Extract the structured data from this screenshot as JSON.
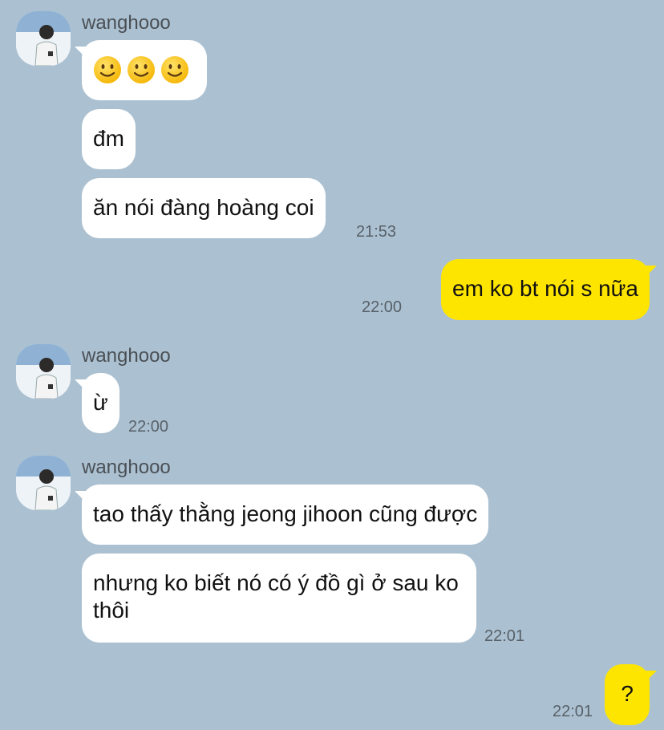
{
  "theme": {
    "background": "#abc1d1",
    "incoming_bubble": "#ffffff",
    "outgoing_bubble": "#fee500"
  },
  "groups": [
    {
      "sender": "wanghooo",
      "avatar_icon": "user-photo-avatar",
      "messages": [
        {
          "type": "emoji",
          "emojis": [
            "slightly-smiling-face-icon",
            "slightly-smiling-face-icon",
            "slightly-smiling-face-icon"
          ]
        },
        {
          "type": "text",
          "text": "đm"
        },
        {
          "type": "text",
          "text": "ăn nói đàng hoàng coi"
        }
      ],
      "time": "21:53"
    },
    {
      "outgoing": true,
      "messages": [
        {
          "type": "text",
          "text": "em ko bt nói s nữa"
        }
      ],
      "time": "22:00"
    },
    {
      "sender": "wanghooo",
      "avatar_icon": "user-photo-avatar",
      "messages": [
        {
          "type": "text",
          "text": "ừ"
        }
      ],
      "time": "22:00"
    },
    {
      "sender": "wanghooo",
      "avatar_icon": "user-photo-avatar",
      "messages": [
        {
          "type": "text",
          "text": "tao thấy thằng jeong jihoon cũng được"
        },
        {
          "type": "text",
          "text": "nhưng ko biết nó có ý đồ gì ở sau ko thôi"
        }
      ],
      "time": "22:01"
    },
    {
      "outgoing": true,
      "messages": [
        {
          "type": "text",
          "text": "?"
        }
      ],
      "time": "22:01"
    }
  ]
}
